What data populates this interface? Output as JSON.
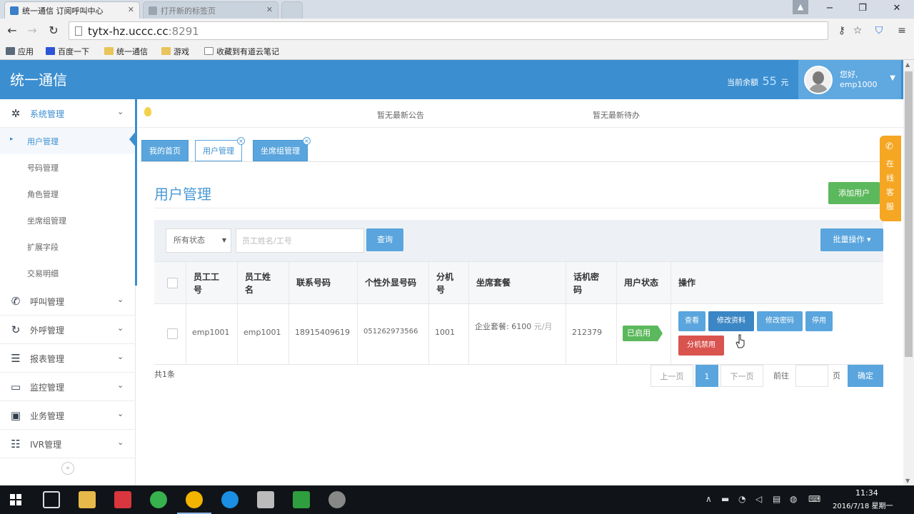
{
  "browser": {
    "tabs": [
      {
        "title": "统一通信 订阅呼叫中心",
        "active": true
      },
      {
        "title": "打开新的标签页",
        "active": false
      }
    ],
    "url_host": "tytx-hz.uccc.cc",
    "url_port": ":8291",
    "bookmarks": [
      {
        "label": "应用",
        "icon": "apps-icon"
      },
      {
        "label": "百度一下",
        "icon": "baidu-icon"
      },
      {
        "label": "统一通信",
        "icon": "folder-icon"
      },
      {
        "label": "游戏",
        "icon": "folder-icon"
      },
      {
        "label": "收藏到有道云笔记",
        "icon": "page-icon"
      }
    ]
  },
  "header": {
    "logo": "统一通信",
    "balance_label": "当前余额",
    "balance_amount": "55",
    "balance_unit": "元",
    "user_greeting": "您好,",
    "username": "emp1000"
  },
  "notices": {
    "announcement": "暂无最新公告",
    "todo": "暂无最新待办"
  },
  "sidebar": {
    "groups": [
      {
        "label": "系统管理",
        "icon": "gear-icon",
        "expanded": true
      },
      {
        "label": "呼叫管理",
        "icon": "phone-icon"
      },
      {
        "label": "外呼管理",
        "icon": "outbound-call-icon"
      },
      {
        "label": "报表管理",
        "icon": "list-icon"
      },
      {
        "label": "监控管理",
        "icon": "monitor-icon"
      },
      {
        "label": "业务管理",
        "icon": "briefcase-icon"
      },
      {
        "label": "IVR管理",
        "icon": "ivr-icon"
      }
    ],
    "sub_items": [
      {
        "label": "用户管理",
        "active": true
      },
      {
        "label": "号码管理"
      },
      {
        "label": "角色管理"
      },
      {
        "label": "坐席组管理"
      },
      {
        "label": "扩展字段"
      },
      {
        "label": "交易明细"
      }
    ]
  },
  "page_tabs": [
    {
      "label": "我的首页"
    },
    {
      "label": "用户管理",
      "active": true
    },
    {
      "label": "坐席组管理"
    }
  ],
  "page": {
    "title": "用户管理",
    "add_button": "添加用户"
  },
  "filter": {
    "status_value": "所有状态",
    "search_placeholder": "员工姓名/工号",
    "search_button": "查询",
    "batch_button": "批量操作"
  },
  "table": {
    "headers": [
      "员工工号",
      "员工姓名",
      "联系号码",
      "个性外显号码",
      "分机号",
      "坐席套餐",
      "话机密码",
      "用户状态",
      "操作"
    ],
    "rows": [
      {
        "emp_id": "emp1001",
        "emp_name": "emp1001",
        "phone": "18915409619",
        "display_number": "051262973566",
        "extension": "1001",
        "package": "企业套餐: 6100",
        "package_suffix": "元/月",
        "phone_password": "212379",
        "status": "已启用",
        "actions": [
          "查看",
          "修改资料",
          "修改密码",
          "停用",
          "分机禁用"
        ]
      }
    ]
  },
  "pager": {
    "total": "共1条",
    "prev": "上一页",
    "current": "1",
    "next": "下一页",
    "goto_label": "前往",
    "page_unit": "页",
    "confirm": "确定"
  },
  "support_widget": {
    "text": "在线客服"
  },
  "taskbar": {
    "time": "11:34",
    "date": "2016/7/18 星期一"
  },
  "colors": {
    "header_blue": "#3b8ed0",
    "button_blue": "#5aa5dd",
    "success_green": "#5cb85c",
    "danger_red": "#d9534f",
    "support_orange": "#f5a623"
  }
}
